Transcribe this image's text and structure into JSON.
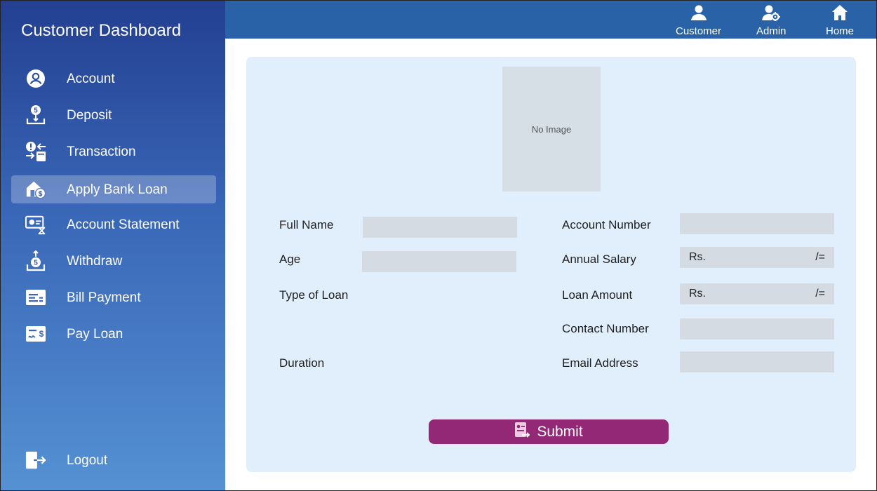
{
  "sidebar": {
    "title": "Customer Dashboard",
    "items": [
      {
        "label": "Account",
        "icon": "user-circle-icon",
        "active": false
      },
      {
        "label": "Deposit",
        "icon": "deposit-icon",
        "active": false
      },
      {
        "label": "Transaction",
        "icon": "transaction-icon",
        "active": false
      },
      {
        "label": "Apply Bank Loan",
        "icon": "house-loan-icon",
        "active": true
      },
      {
        "label": "Account Statement",
        "icon": "statement-icon",
        "active": false
      },
      {
        "label": "Withdraw",
        "icon": "withdraw-icon",
        "active": false
      },
      {
        "label": "Bill Payment",
        "icon": "bill-icon",
        "active": false
      },
      {
        "label": "Pay Loan",
        "icon": "pay-loan-icon",
        "active": false
      }
    ],
    "logout": {
      "label": "Logout",
      "icon": "logout-icon"
    }
  },
  "topbar": {
    "customer": "Customer",
    "admin": "Admin",
    "home": "Home"
  },
  "form": {
    "no_image": "No Image",
    "full_name": "Full Name",
    "age": "Age",
    "type_of_loan": "Type of Loan",
    "duration": "Duration",
    "account_number": "Account Number",
    "annual_salary": "Annual Salary",
    "loan_amount": "Loan Amount",
    "contact_number": "Contact Number",
    "email_address": "Email Address",
    "currency_prefix": "Rs.",
    "currency_suffix": "/=",
    "submit": "Submit"
  },
  "colors": {
    "sidebar_top": "#233f91",
    "sidebar_bottom": "#5591d3",
    "topbar": "#2a62a8",
    "panel": "#e1effd",
    "field": "#d4dbe2",
    "submit": "#932876"
  }
}
